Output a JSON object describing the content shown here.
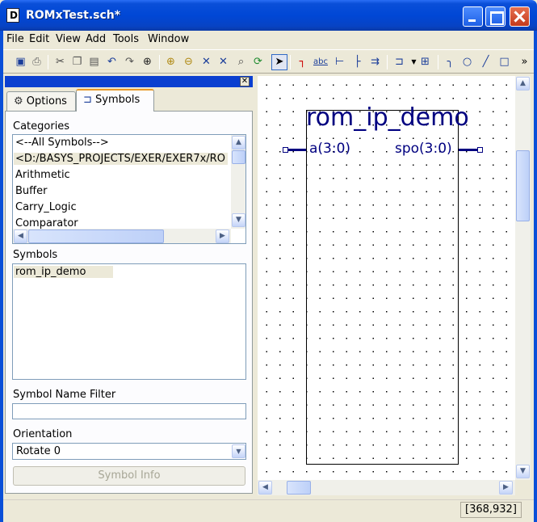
{
  "window": {
    "title": "ROMxTest.sch*"
  },
  "menu": [
    "File",
    "Edit",
    "View",
    "Add",
    "Tools",
    "Window"
  ],
  "toolbar": {
    "icons": [
      "save-icon",
      "print-icon",
      "cut-icon",
      "copy-icon",
      "paste-icon",
      "undo-icon",
      "redo-icon",
      "find-icon",
      "zoom-in-icon",
      "zoom-out-icon",
      "zoom-fit-icon",
      "zoom-selection-icon",
      "zoom-area-icon",
      "refresh-icon",
      "select-icon",
      "add-wire-icon",
      "add-net-name-icon",
      "add-bus-tap-icon",
      "add-bus-entry-icon",
      "add-io-marker-icon",
      "add-symbol-icon",
      "add-instance-icon",
      "add-arc-icon",
      "add-circle-icon",
      "add-line-icon",
      "add-rectangle-icon",
      "more-icon"
    ],
    "abc_label": "abc",
    "more_label": "»"
  },
  "panel": {
    "tabs": [
      {
        "label": "Options",
        "icon": "options-icon"
      },
      {
        "label": "Symbols",
        "icon": "symbols-icon"
      }
    ],
    "categories_label": "Categories",
    "categories": [
      "<--All Symbols-->",
      "<D:/BASYS_PROJECTS/EXER/EXER7x/RO",
      "Arithmetic",
      "Buffer",
      "Carry_Logic",
      "Comparator"
    ],
    "symbols_label": "Symbols",
    "symbols": [
      "rom_ip_demo"
    ],
    "filter_label": "Symbol Name Filter",
    "filter_value": "",
    "orientation_label": "Orientation",
    "orientation_value": "Rotate 0",
    "symbol_info_label": "Symbol Info"
  },
  "schematic": {
    "symbol_name": "rom_ip_demo",
    "pin_left": "a(3:0)",
    "pin_right": "spo(3:0)",
    "accent": "#000080"
  },
  "status": {
    "coords": "[368,932]"
  }
}
